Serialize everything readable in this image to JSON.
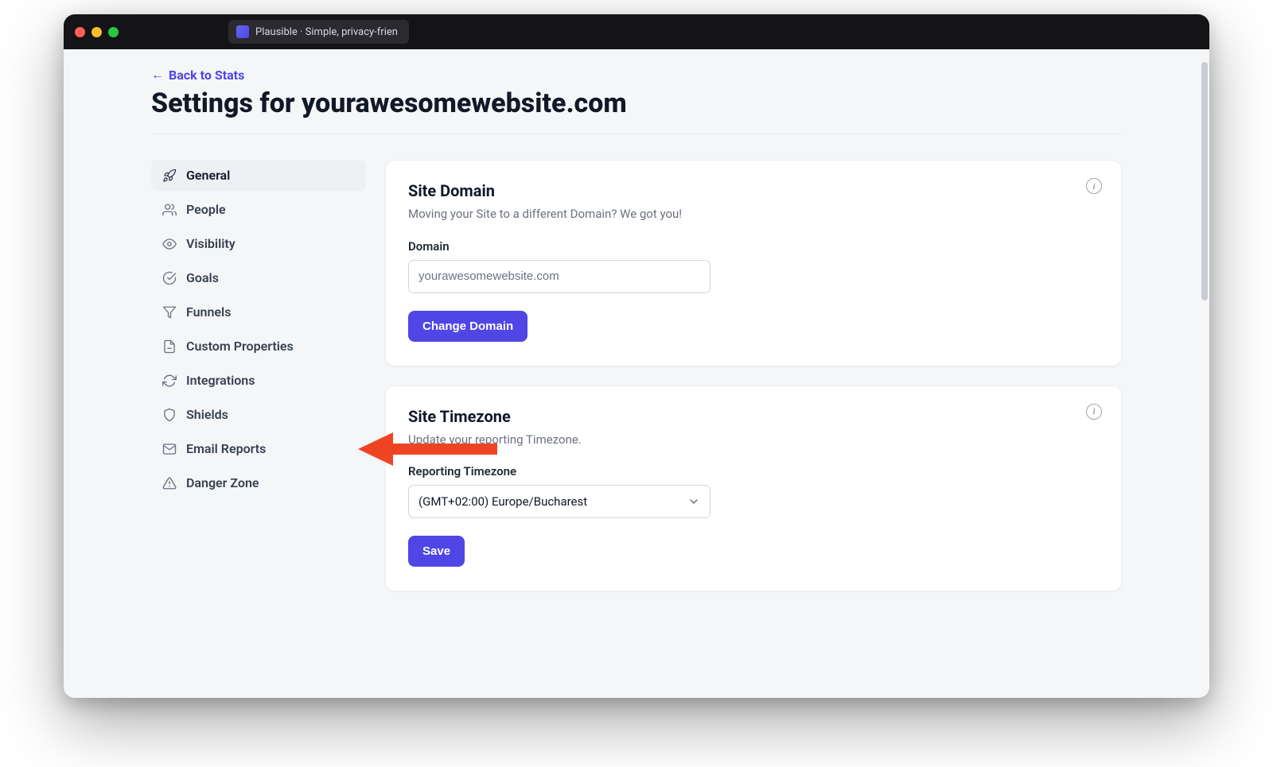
{
  "window": {
    "tab_title": "Plausible · Simple, privacy-frien"
  },
  "header": {
    "back_link": "Back to Stats",
    "title": "Settings for yourawesomewebsite.com"
  },
  "sidebar": {
    "items": [
      {
        "id": "general",
        "label": "General",
        "icon": "rocket-icon",
        "active": true
      },
      {
        "id": "people",
        "label": "People",
        "icon": "users-icon",
        "active": false
      },
      {
        "id": "visibility",
        "label": "Visibility",
        "icon": "eye-icon",
        "active": false
      },
      {
        "id": "goals",
        "label": "Goals",
        "icon": "check-circle-icon",
        "active": false
      },
      {
        "id": "funnels",
        "label": "Funnels",
        "icon": "funnel-icon",
        "active": false
      },
      {
        "id": "custom-properties",
        "label": "Custom Properties",
        "icon": "document-icon",
        "active": false
      },
      {
        "id": "integrations",
        "label": "Integrations",
        "icon": "sync-icon",
        "active": false
      },
      {
        "id": "shields",
        "label": "Shields",
        "icon": "shield-icon",
        "active": false
      },
      {
        "id": "email-reports",
        "label": "Email Reports",
        "icon": "mail-icon",
        "active": false
      },
      {
        "id": "danger-zone",
        "label": "Danger Zone",
        "icon": "warning-icon",
        "active": false
      }
    ]
  },
  "cards": {
    "domain": {
      "title": "Site Domain",
      "subtitle": "Moving your Site to a different Domain? We got you!",
      "field_label": "Domain",
      "field_value": "yourawesomewebsite.com",
      "button": "Change Domain"
    },
    "timezone": {
      "title": "Site Timezone",
      "subtitle": "Update your reporting Timezone.",
      "field_label": "Reporting Timezone",
      "selected": "(GMT+02:00) Europe/Bucharest",
      "button": "Save"
    }
  },
  "colors": {
    "accent": "#4f46e5",
    "text": "#111827",
    "muted": "#6b7280",
    "border": "#d1d5db",
    "annotation": "#ef4423"
  }
}
